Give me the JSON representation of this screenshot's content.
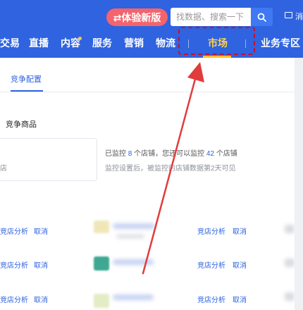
{
  "header": {
    "experience_button": "⇄体验新版",
    "search_placeholder": "找数据、搜索一下",
    "message_label": "消"
  },
  "nav": {
    "items": [
      "交易",
      "直播",
      "内容",
      "服务",
      "营销",
      "物流",
      "市场",
      "业务专区"
    ]
  },
  "tabs": {
    "active": "竞争配置"
  },
  "section": {
    "title": "竞争商品",
    "card_text": "店"
  },
  "monitor_info": {
    "prefix": "已监控",
    "monitored": "8",
    "middle": "个店铺，您还可以监控",
    "remaining": "42",
    "suffix": "个店铺",
    "note": "监控设置后，被监控的店铺数据第2天可见"
  },
  "rows": {
    "left_actions": [
      "竞店分析",
      "取消"
    ],
    "right_actions": [
      "竞店分析",
      "取消"
    ]
  },
  "colors": {
    "brand_blue": "#2f63e0",
    "highlight_red": "#c8102e",
    "experience_pink": "#f4646c",
    "active_underline": "#ffbf2e"
  }
}
